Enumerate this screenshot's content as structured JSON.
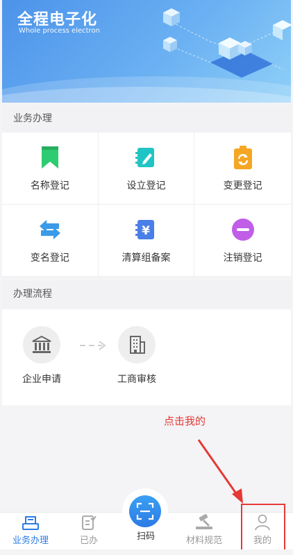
{
  "banner": {
    "title": "全程电子化",
    "subtitle": "Whole process electron"
  },
  "sections": {
    "business": "业务办理",
    "process": "办理流程"
  },
  "services": [
    {
      "label": "名称登记",
      "icon": "bookmark-icon",
      "color": "#2ecc71"
    },
    {
      "label": "设立登记",
      "icon": "notebook-edit-icon",
      "color": "#21c4c4"
    },
    {
      "label": "变更登记",
      "icon": "clipboard-refresh-icon",
      "color": "#f5a623"
    },
    {
      "label": "变名登记",
      "icon": "swap-arrows-icon",
      "color": "#3a9be8"
    },
    {
      "label": "清算组备案",
      "icon": "yen-ledger-icon",
      "color": "#4a7ee8"
    },
    {
      "label": "注销登记",
      "icon": "minus-circle-icon",
      "color": "#c05ee8"
    }
  ],
  "flow": [
    {
      "label": "企业申请",
      "icon": "bank-icon"
    },
    {
      "label": "工商审核",
      "icon": "office-building-icon"
    }
  ],
  "hint": "点击我的",
  "tabs": [
    {
      "label": "业务办理",
      "icon": "business-tab-icon",
      "active": true
    },
    {
      "label": "已办",
      "icon": "done-tab-icon",
      "active": false
    },
    {
      "label": "扫码",
      "icon": "scan-icon",
      "active": false
    },
    {
      "label": "材料规范",
      "icon": "gavel-icon",
      "active": false
    },
    {
      "label": "我的",
      "icon": "user-icon",
      "active": false
    }
  ],
  "colors": {
    "accent": "#2c7be5",
    "annotation": "#e53935"
  }
}
